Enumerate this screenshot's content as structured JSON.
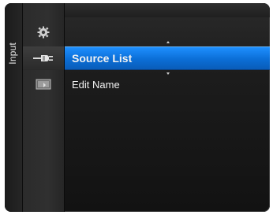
{
  "side_tab": {
    "label": "Input"
  },
  "icons": [
    {
      "name": "gear-icon"
    },
    {
      "name": "plug-input-icon"
    },
    {
      "name": "tv-input-icon"
    }
  ],
  "menu": {
    "items": [
      {
        "label": "Source List",
        "selected": true
      },
      {
        "label": "Edit Name",
        "selected": false
      }
    ]
  },
  "colors": {
    "selection_accent": "#1e8fff",
    "panel_background": "#1c1c1c"
  }
}
